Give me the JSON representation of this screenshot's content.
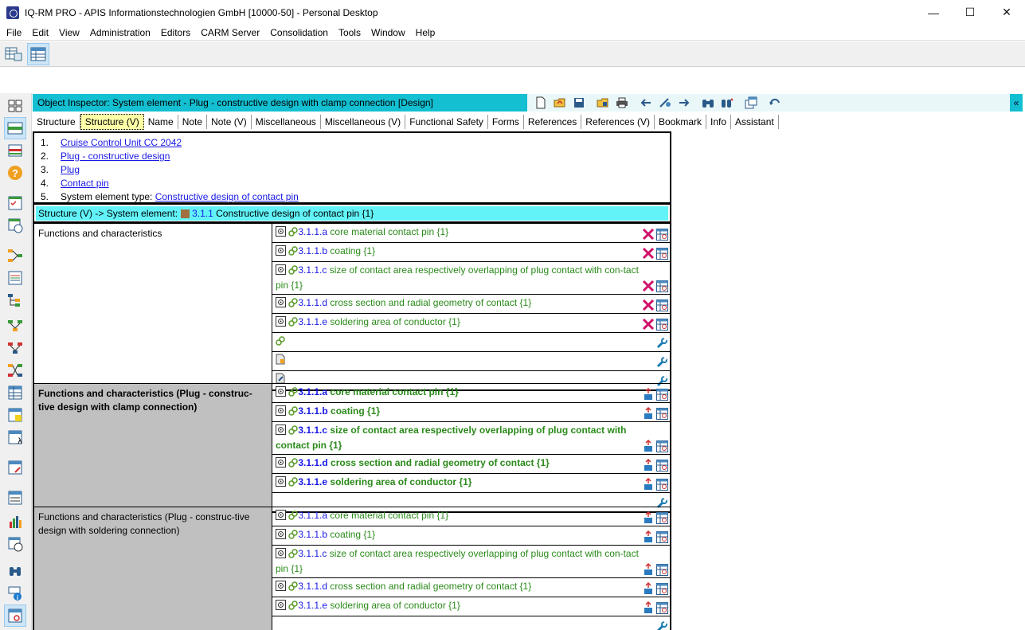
{
  "window": {
    "title": "IQ-RM PRO - APIS Informationstechnologien GmbH [10000-50] - Personal Desktop",
    "minimize": "—",
    "maximize": "☐",
    "close": "✕"
  },
  "menu": [
    "File",
    "Edit",
    "View",
    "Administration",
    "Editors",
    "CARM Server",
    "Consolidation",
    "Tools",
    "Window",
    "Help"
  ],
  "inspector": {
    "title": "Object Inspector: System element - Plug - constructive design with clamp connection [Design]",
    "collapse": "«"
  },
  "tabs": [
    "Structure",
    "Structure (V)",
    "Name",
    "Note",
    "Note (V)",
    "Miscellaneous",
    "Miscellaneous (V)",
    "Functional Safety",
    "Forms",
    "References",
    "References (V)",
    "Bookmark",
    "Info",
    "Assistant"
  ],
  "active_tab": "Structure (V)",
  "path": [
    {
      "num": "1.",
      "prefix": "",
      "link": "Cruise Control Unit CC 2042"
    },
    {
      "num": "2.",
      "prefix": "",
      "link": "Plug - constructive design"
    },
    {
      "num": "3.",
      "prefix": "",
      "link": "Plug"
    },
    {
      "num": "4.",
      "prefix": "",
      "link": "Contact pin"
    },
    {
      "num": "5.",
      "prefix": "System element type: ",
      "link": "Constructive design of contact pin"
    }
  ],
  "structure_bar": {
    "prefix": "Structure (V) -> System element:",
    "number": "3.1.1",
    "name": "Constructive design of contact pin {1}"
  },
  "sections": [
    {
      "label": "Functions and characteristics",
      "rows": [
        {
          "num": "3.1.1.a",
          "text": "core material contact pin {1}"
        },
        {
          "num": "3.1.1.b",
          "text": "coating {1}"
        },
        {
          "num": "3.1.1.c",
          "text": "size of contact area respectively overlapping of plug contact with con-tact pin {1}"
        },
        {
          "num": "3.1.1.d",
          "text": "cross section and radial geometry of contact {1}"
        },
        {
          "num": "3.1.1.e",
          "text": "soldering area of conductor {1}"
        }
      ]
    },
    {
      "label": "Functions and characteristics (Plug - construc-tive design with clamp connection)",
      "rows": [
        {
          "num": "3.1.1.a",
          "text": "core material contact pin {1}"
        },
        {
          "num": "3.1.1.b",
          "text": "coating {1}"
        },
        {
          "num": "3.1.1.c",
          "text": "size of contact area respectively overlapping of plug contact with contact pin {1}"
        },
        {
          "num": "3.1.1.d",
          "text": "cross section and radial geometry of contact {1}"
        },
        {
          "num": "3.1.1.e",
          "text": "soldering area of conductor {1}"
        }
      ]
    },
    {
      "label": "Functions and characteristics (Plug - construc-tive design with soldering connection)",
      "rows": [
        {
          "num": "3.1.1.a",
          "text": "core material contact pin {1}"
        },
        {
          "num": "3.1.1.b",
          "text": "coating {1}"
        },
        {
          "num": "3.1.1.c",
          "text": "size of contact area respectively overlapping of plug contact with con-tact pin {1}"
        },
        {
          "num": "3.1.1.d",
          "text": "cross section and radial geometry of contact {1}"
        },
        {
          "num": "3.1.1.e",
          "text": "soldering area of conductor {1}"
        }
      ]
    }
  ],
  "colors": {
    "inspector_header": "#13bfd1",
    "structure_bar": "#62f3f8",
    "link": "#1a1ae6",
    "item_text": "#2a8a1a",
    "delete": "#d0106a",
    "section_gray": "#c0c0c0"
  }
}
